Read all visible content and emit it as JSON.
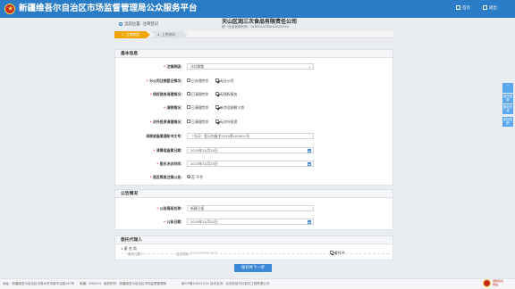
{
  "header": {
    "title": "新疆维吾尔自治区市场监督管理局公众服务平台",
    "home_label": "首页",
    "logout_label": "退出"
  },
  "breadcrumb": {
    "location_label": "当前位置: 注销登记"
  },
  "company": {
    "name": "天山区润三次食品有限责任公司",
    "credit_code": "统一社会信用代码：91650102MA7A0297XG"
  },
  "steps": [
    {
      "label": "1. 注销前提"
    },
    {
      "label": "2. 上传材料"
    }
  ],
  "basic_info": {
    "section_title": "基本信息",
    "fields": {
      "cancel_reason": {
        "label": "注销原因：",
        "value": "决议解散"
      },
      "branch": {
        "label": "分公司注销登记情况：",
        "options": [
          {
            "text": "已办理完毕",
            "checked": false
          },
          {
            "text": "无分公司",
            "checked": true
          }
        ]
      },
      "debt": {
        "label": "债权债务清理情况：",
        "options": [
          {
            "text": "已清理完毕",
            "checked": false
          },
          {
            "text": "无债权债务",
            "checked": true
          }
        ]
      },
      "settlement": {
        "label": "清税情况：",
        "options": [
          {
            "text": "已清理完毕",
            "checked": false
          },
          {
            "text": "未涉及纳税义务",
            "checked": true
          }
        ]
      },
      "invest": {
        "label": "对外投资清理情况：",
        "options": [
          {
            "text": "已清理完毕",
            "checked": false
          },
          {
            "text": "无对外投资",
            "checked": true
          }
        ]
      },
      "tax_doc": {
        "label": "清税或备案通知书文号：",
        "value": "（乌天）登记内备字2019第100001号"
      },
      "decision_date": {
        "label": "清算组备案日期：",
        "value": "2019年10月24日"
      },
      "resolution_date": {
        "label": "股东决议时间：",
        "value": "2019年10月23日"
      },
      "announce": {
        "label": "是否简易注销公告：",
        "option": "否 不予"
      }
    }
  },
  "announcement": {
    "section_title": "公告情况",
    "fields": {
      "media": {
        "label": "公告报纸名称：",
        "value": "新疆日报"
      },
      "date": {
        "label": "公告日期：",
        "value": "2019年10月02日"
      }
    }
  },
  "agent": {
    "section_title": "委托代理人",
    "index_name": "1  蔡 名 尚",
    "name_label": "委托代理人：",
    "id_label": "证件号码：",
    "id_value": "6501********4424",
    "check_label": "委托书",
    "check_checked": true
  },
  "actions": {
    "next_label": "保存并下一步"
  },
  "side_buttons": [
    {
      "label": "在线咨询"
    },
    {
      "label": "操作指南"
    },
    {
      "label": "服务热线"
    },
    {
      "label": "返回顶部"
    }
  ],
  "footer": {
    "address": "地址：新疆维吾尔自治区乌鲁木齐市新华北路167号",
    "postcode": "邮编：830004",
    "sponsor": "版权所有：新疆维吾尔自治区市场监督管理局",
    "icp": "新ICP备10001234",
    "tech": "技术支持：北京航信华仪软件工程有限公司",
    "emblem_text": "党政机关\n网站"
  },
  "colors": {
    "header_bg": "#2a7cc7",
    "step_active": "#f0a500",
    "primary_button": "#3d88d6",
    "required": "#e33333"
  }
}
